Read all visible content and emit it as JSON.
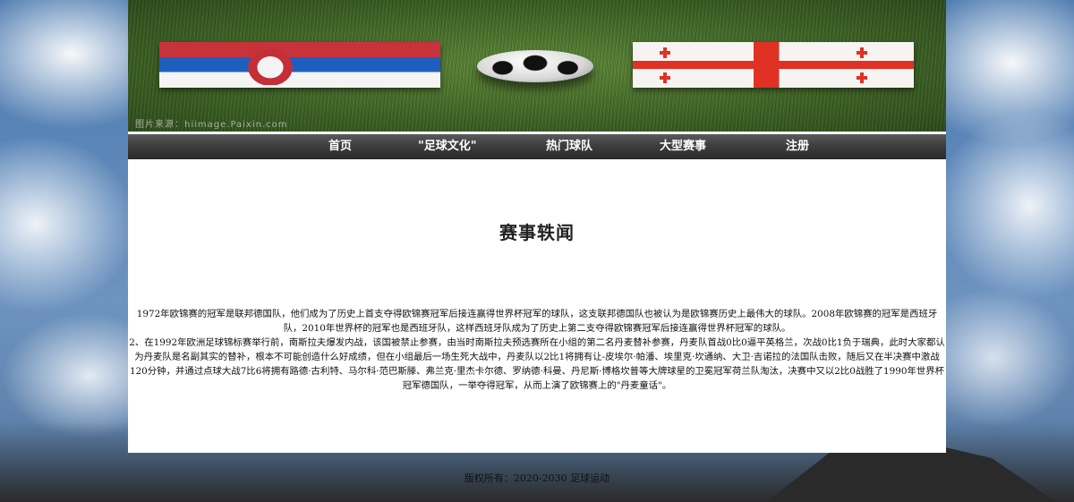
{
  "banner": {
    "watermark": "图片来源：hiimage.Paixin.com"
  },
  "nav": {
    "items": [
      {
        "label": "首页"
      },
      {
        "label": "\"足球文化\""
      },
      {
        "label": "热门球队"
      },
      {
        "label": "大型赛事"
      },
      {
        "label": "注册"
      }
    ]
  },
  "main": {
    "title": "赛事轶闻",
    "paragraph1": "1972年欧锦赛的冠军是联邦德国队，他们成为了历史上首支夺得欧锦赛冠军后接连赢得世界杯冠军的球队，这支联邦德国队也被认为是欧锦赛历史上最伟大的球队。2008年欧锦赛的冠军是西班牙队，2010年世界杯的冠军也是西班牙队，这样西班牙队成为了历史上第二支夺得欧锦赛冠军后接连赢得世界杯冠军的球队。",
    "paragraph2": "2、在1992年欧洲足球锦标赛举行前，南斯拉夫爆发内战，该国被禁止参赛，由当时南斯拉夫预选赛所在小组的第二名丹麦替补参赛，丹麦队首战0比0逼平英格兰，次战0比1负于瑞典，此时大家都认为丹麦队是名副其实的替补，根本不可能创造什么好成绩，但在小组最后一场生死大战中，丹麦队以2比1将拥有让-皮埃尔·帕潘、埃里克·坎通纳、大卫·吉诺拉的法国队击败，随后又在半决赛中激战120分钟，并通过点球大战7比6将拥有路德·古利特、马尔科·范巴斯滕、弗兰克·里杰卡尔德、罗纳德·科曼、丹尼斯·博格坎普等大牌球星的卫冕冠军荷兰队淘汰，决赛中又以2比0战胜了1990年世界杯冠军德国队，一举夺得冠军，从而上演了欧锦赛上的\"丹麦童话\"。"
  },
  "footer": {
    "text": "版权所有：2020-2030 足球运动"
  }
}
